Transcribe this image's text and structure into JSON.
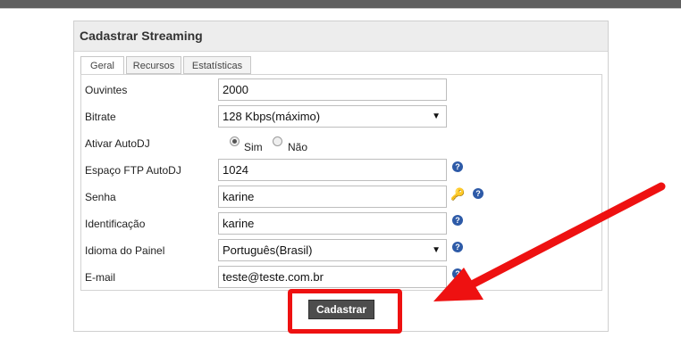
{
  "panel": {
    "title": "Cadastrar Streaming"
  },
  "tabs": [
    {
      "label": "Geral",
      "active": true
    },
    {
      "label": "Recursos",
      "active": false
    },
    {
      "label": "Estatísticas",
      "active": false
    }
  ],
  "form": {
    "ouvintes": {
      "label": "Ouvintes",
      "value": "2000"
    },
    "bitrate": {
      "label": "Bitrate",
      "value": "128 Kbps(máximo)"
    },
    "autodj": {
      "label": "Ativar AutoDJ",
      "options": [
        "Sim",
        "Não"
      ],
      "selected": "Sim"
    },
    "ftp": {
      "label": "Espaço FTP AutoDJ",
      "value": "1024"
    },
    "senha": {
      "label": "Senha",
      "value": "karine"
    },
    "identificacao": {
      "label": "Identificação",
      "value": "karine"
    },
    "idioma": {
      "label": "Idioma do Painel",
      "value": "Português(Brasil)"
    },
    "email": {
      "label": "E-mail",
      "value": "teste@teste.com.br"
    }
  },
  "submit": {
    "label": "Cadastrar"
  },
  "icons": {
    "help": "?",
    "dropdown": "▼",
    "key": "🔑"
  },
  "colors": {
    "annotation": "#ee1111",
    "help_icon": "#2d5aa7",
    "button": "#4d4d4d"
  }
}
